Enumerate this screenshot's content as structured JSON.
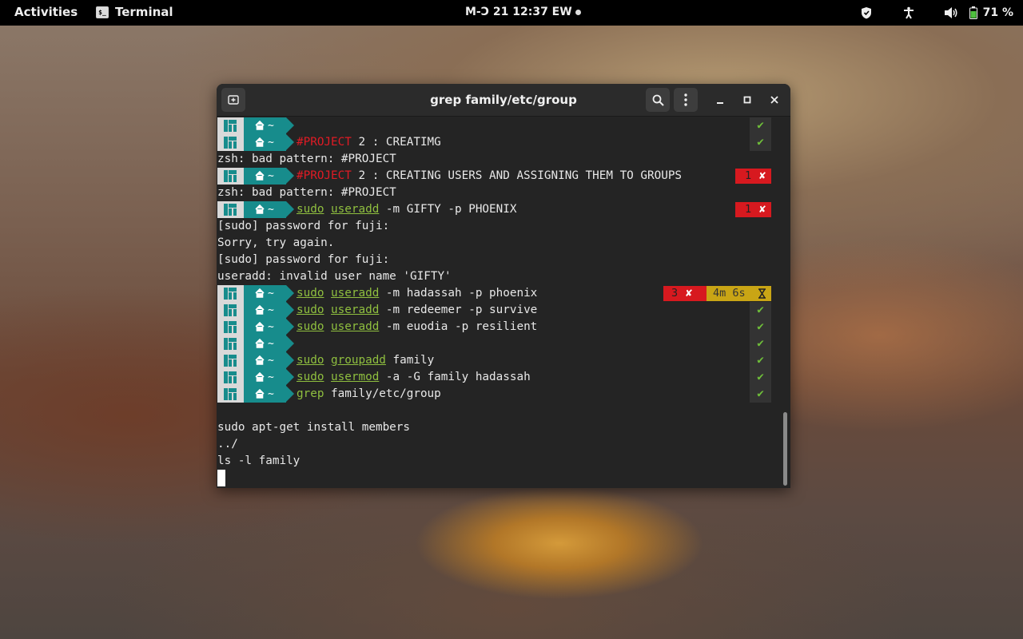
{
  "topbar": {
    "activities": "Activities",
    "app_name": "Terminal",
    "clock": "M-Ɔ 21  12:37 EW",
    "battery_pct": "71 %"
  },
  "window": {
    "title": "grep family/etc/group"
  },
  "prompt": {
    "home_tilde": "~"
  },
  "lines": {
    "l3_proj": "#PROJECT",
    "l3_rest": " 2 : CREATIMG",
    "l4": "zsh: bad pattern: #PROJECT",
    "l5_proj": "#PROJECT",
    "l5_rest": " 2 : CREATING USERS AND ASSIGNING THEM TO GROUPS",
    "l5_code": "1",
    "l6": "zsh: bad pattern: #PROJECT",
    "l7_sudo": "sudo",
    "l7_cmd": "useradd",
    "l7_rest": " -m GIFTY -p PHOENIX",
    "l7_code": "1",
    "l8": "[sudo] password for fuji:",
    "l9": "Sorry, try again.",
    "l10": "[sudo] password for fuji:",
    "l11": "useradd: invalid user name 'GIFTY'",
    "l12_sudo": "sudo",
    "l12_cmd": "useradd",
    "l12_rest": " -m hadassah -p phoenix",
    "l12_code": "3",
    "l12_time": "4m 6s",
    "l13_sudo": "sudo",
    "l13_cmd": "useradd",
    "l13_rest": " -m redeemer -p survive",
    "l14_sudo": "sudo",
    "l14_cmd": "useradd",
    "l14_rest": " -m euodia -p resilient",
    "l16_sudo": "sudo",
    "l16_cmd": "groupadd",
    "l16_rest": " family",
    "l17_sudo": "sudo",
    "l17_cmd": "usermod",
    "l17_rest": " -a -G family hadassah",
    "l18_cmd": "grep",
    "l18_rest": " family/etc/group",
    "l20": "sudo apt-get install members",
    "l21": "../",
    "l22": "ls -l family"
  },
  "status": {
    "ok_mark": "✔",
    "err_mark": "✘"
  },
  "colors": {
    "teal": "#178c8c",
    "error": "#d7191f",
    "warn": "#c9a515",
    "ok": "#6fbf3a"
  }
}
